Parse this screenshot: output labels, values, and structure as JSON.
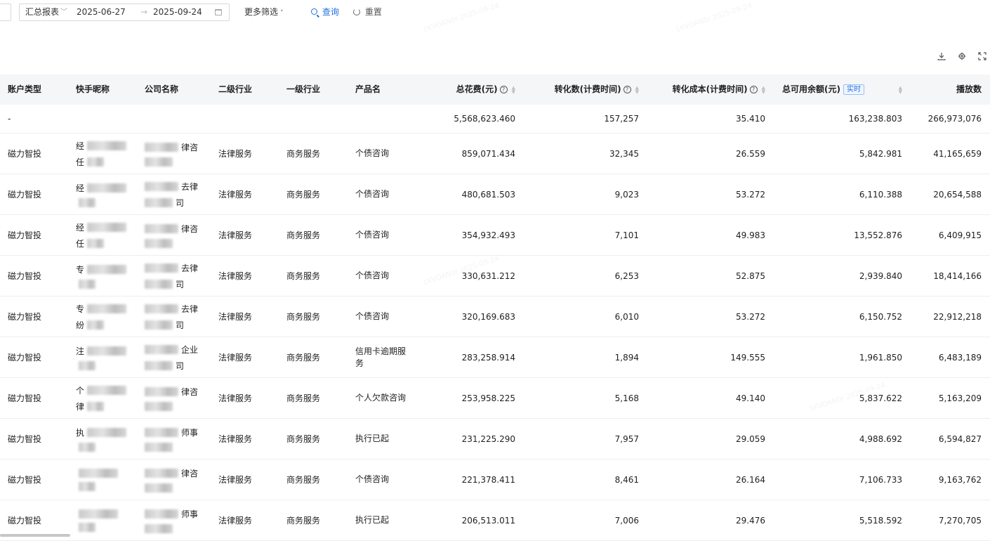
{
  "filters": {
    "report_type": "汇总报表",
    "date_start": "2025-06-27",
    "date_arrow": "→",
    "date_end": "2025-09-24",
    "more_filter_label": "更多筛选",
    "more_filter_chevron": "˅",
    "query_label": "查询",
    "reset_label": "重置"
  },
  "toolbar": {
    "download_icon": "download-icon",
    "settings_icon": "settings-icon",
    "fullscreen_icon": "fullscreen-icon"
  },
  "table": {
    "columns": [
      {
        "label": "账户类型"
      },
      {
        "label": "快手昵称"
      },
      {
        "label": "公司名称"
      },
      {
        "label": "二级行业"
      },
      {
        "label": "一级行业"
      },
      {
        "label": "产品名"
      },
      {
        "label": "总花费(元)"
      },
      {
        "label": "转化数(计费时间)"
      },
      {
        "label": "转化成本(计费时间)"
      },
      {
        "label": "总可用余额(元)",
        "tag": "实时"
      },
      {
        "label": "播放数"
      }
    ],
    "summary": {
      "account_type": "-",
      "total_spend": "5,568,623.460",
      "conversions": "157,257",
      "conversion_cost": "35.410",
      "balance": "163,238.803",
      "plays": "266,973,076"
    },
    "rows": [
      {
        "account_type": "磁力智投",
        "nick_a": "经",
        "nick_b": "任",
        "company_a": "律咨",
        "company_b": "",
        "industry2": "法律服务",
        "industry1": "商务服务",
        "product": "个债咨询",
        "total_spend": "859,071.434",
        "conversions": "32,345",
        "conversion_cost": "26.559",
        "balance": "5,842.981",
        "plays": "41,165,659"
      },
      {
        "account_type": "磁力智投",
        "nick_a": "经",
        "nick_b": "",
        "company_a": "去律",
        "company_b": "司",
        "industry2": "法律服务",
        "industry1": "商务服务",
        "product": "个债咨询",
        "total_spend": "480,681.503",
        "conversions": "9,023",
        "conversion_cost": "53.272",
        "balance": "6,110.388",
        "plays": "20,654,588"
      },
      {
        "account_type": "磁力智投",
        "nick_a": "经",
        "nick_b": "任",
        "company_a": "律咨",
        "company_b": "",
        "industry2": "法律服务",
        "industry1": "商务服务",
        "product": "个债咨询",
        "total_spend": "354,932.493",
        "conversions": "7,101",
        "conversion_cost": "49.983",
        "balance": "13,552.876",
        "plays": "6,409,915"
      },
      {
        "account_type": "磁力智投",
        "nick_a": "专",
        "nick_b": "",
        "company_a": "去律",
        "company_b": "司",
        "industry2": "法律服务",
        "industry1": "商务服务",
        "product": "个债咨询",
        "total_spend": "330,631.212",
        "conversions": "6,253",
        "conversion_cost": "52.875",
        "balance": "2,939.840",
        "plays": "18,414,166"
      },
      {
        "account_type": "磁力智投",
        "nick_a": "专",
        "nick_b": "纷",
        "company_a": "去律",
        "company_b": "司",
        "industry2": "法律服务",
        "industry1": "商务服务",
        "product": "个债咨询",
        "total_spend": "320,169.683",
        "conversions": "6,010",
        "conversion_cost": "53.272",
        "balance": "6,150.752",
        "plays": "22,912,218"
      },
      {
        "account_type": "磁力智投",
        "nick_a": "注",
        "nick_b": "",
        "company_a": "企业",
        "company_b": "司",
        "industry2": "法律服务",
        "industry1": "商务服务",
        "product": "信用卡逾期服务",
        "total_spend": "283,258.914",
        "conversions": "1,894",
        "conversion_cost": "149.555",
        "balance": "1,961.850",
        "plays": "6,483,189"
      },
      {
        "account_type": "磁力智投",
        "nick_a": "个",
        "nick_b": "律",
        "company_a": "律咨",
        "company_b": "",
        "industry2": "法律服务",
        "industry1": "商务服务",
        "product": "个人欠款咨询",
        "total_spend": "253,958.225",
        "conversions": "5,168",
        "conversion_cost": "49.140",
        "balance": "5,837.622",
        "plays": "5,163,209"
      },
      {
        "account_type": "磁力智投",
        "nick_a": "执",
        "nick_b": "",
        "company_a": "师事",
        "company_b": "",
        "industry2": "法律服务",
        "industry1": "商务服务",
        "product": "执行已起",
        "total_spend": "231,225.290",
        "conversions": "7,957",
        "conversion_cost": "29.059",
        "balance": "4,988.692",
        "plays": "6,594,827"
      },
      {
        "account_type": "磁力智投",
        "nick_a": "",
        "nick_b": "",
        "company_a": "律咨",
        "company_b": "",
        "industry2": "法律服务",
        "industry1": "商务服务",
        "product": "个债咨询",
        "total_spend": "221,378.411",
        "conversions": "8,461",
        "conversion_cost": "26.164",
        "balance": "7,106.733",
        "plays": "9,163,762"
      },
      {
        "account_type": "磁力智投",
        "nick_a": "",
        "nick_b": "",
        "company_a": "师事",
        "company_b": "",
        "industry2": "法律服务",
        "industry1": "商务服务",
        "product": "执行已起",
        "total_spend": "206,513.011",
        "conversions": "7,006",
        "conversion_cost": "29.476",
        "balance": "5,518.592",
        "plays": "7,270,705"
      }
    ]
  }
}
